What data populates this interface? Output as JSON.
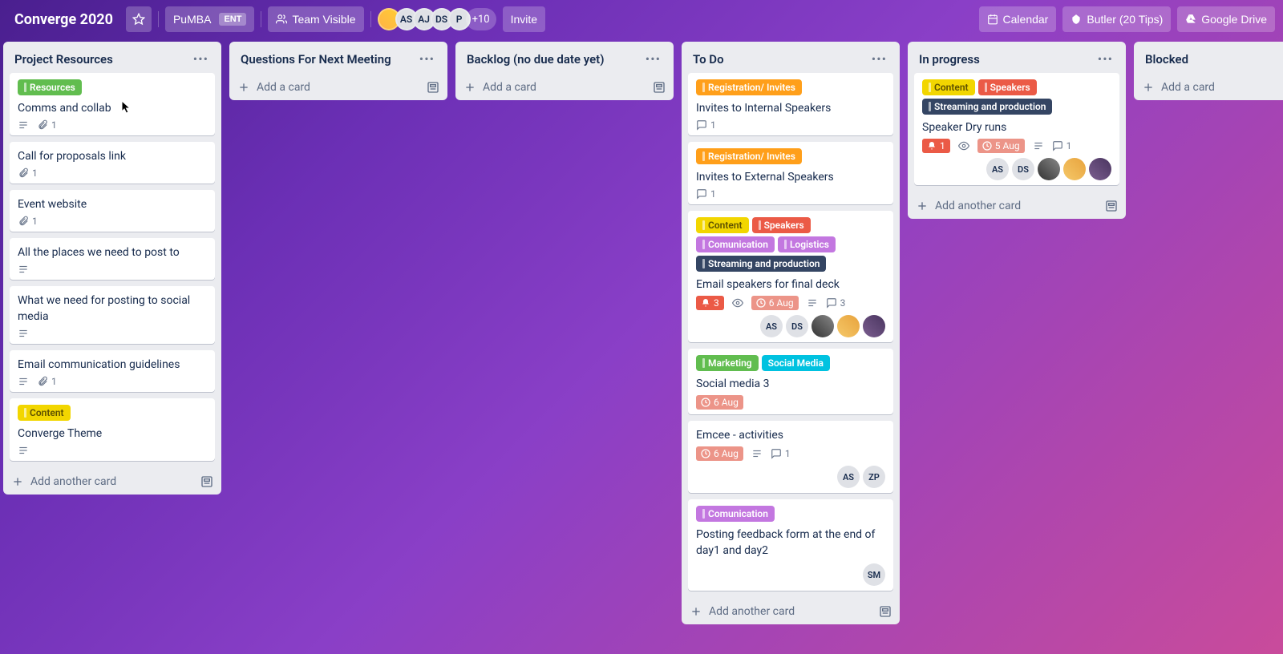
{
  "header": {
    "title": "Converge 2020",
    "org": "PuMBA",
    "org_badge": "ENT",
    "visibility": "Team Visible",
    "members": [
      "",
      "AS",
      "AJ",
      "DS",
      "P"
    ],
    "more_members": "+10",
    "invite": "Invite",
    "buttons": {
      "calendar": "Calendar",
      "butler": "Butler (20 Tips)",
      "gdrive": "Google Drive"
    }
  },
  "labels": {
    "resources": "Resources",
    "content": "Content",
    "speakers": "Speakers",
    "streaming": "Streaming and production",
    "registration": "Registration/ Invites",
    "comunication": "Comunication",
    "logistics": "Logistics",
    "marketing": "Marketing",
    "social": "Social Media"
  },
  "ui": {
    "add_card": "Add a card",
    "add_another": "Add another card"
  },
  "lists": [
    {
      "title": "Project Resources",
      "footer_another": true,
      "cards": [
        {
          "labels": [
            {
              "k": "resources",
              "cls": "lbl-green",
              "stripe": true
            }
          ],
          "title": "Comms and collab",
          "desc": true,
          "att": 1
        },
        {
          "title": "Call for proposals link",
          "att": 1
        },
        {
          "title": "Event website",
          "att": 1
        },
        {
          "title": "All the places we need to post to",
          "desc": true
        },
        {
          "title": "What we need for posting to social media",
          "desc": true
        },
        {
          "title": "Email communication guidelines",
          "desc": true,
          "att": 1
        },
        {
          "labels": [
            {
              "k": "content",
              "cls": "lbl-yellow",
              "stripe": true
            }
          ],
          "title": "Converge Theme",
          "desc": true
        }
      ]
    },
    {
      "title": "Questions For Next Meeting",
      "cards": []
    },
    {
      "title": "Backlog (no due date yet)",
      "cards": []
    },
    {
      "title": "To Do",
      "footer_another": true,
      "cards": [
        {
          "labels": [
            {
              "k": "registration",
              "cls": "lbl-orange",
              "stripe": true
            }
          ],
          "title": "Invites to Internal Speakers",
          "comments": 1
        },
        {
          "labels": [
            {
              "k": "registration",
              "cls": "lbl-orange",
              "stripe": true
            }
          ],
          "title": "Invites to External Speakers",
          "comments": 1
        },
        {
          "labels": [
            {
              "k": "content",
              "cls": "lbl-yellow",
              "stripe": true
            },
            {
              "k": "speakers",
              "cls": "lbl-red",
              "stripe": true
            },
            {
              "k": "comunication",
              "cls": "lbl-purple",
              "stripe": true
            },
            {
              "k": "logistics",
              "cls": "lbl-purple",
              "stripe": true
            },
            {
              "k": "streaming",
              "cls": "lbl-dark",
              "stripe": true
            }
          ],
          "title": "Email speakers for final deck",
          "notif": 3,
          "watch": true,
          "due": "6 Aug",
          "desc": true,
          "comments": 3,
          "members": [
            "AS",
            "DS",
            "img1",
            "img2",
            "img3"
          ]
        },
        {
          "labels": [
            {
              "k": "marketing",
              "cls": "lbl-green",
              "stripe": true
            },
            {
              "k": "social",
              "cls": "lbl-sky"
            }
          ],
          "title": "Social media 3",
          "due": "6 Aug"
        },
        {
          "title": "Emcee - activities",
          "due": "6 Aug",
          "desc": true,
          "comments": 1,
          "members": [
            "AS",
            "ZP"
          ]
        },
        {
          "labels": [
            {
              "k": "comunication",
              "cls": "lbl-purple",
              "stripe": true
            }
          ],
          "title": "Posting feedback form at the end of day1 and day2",
          "members": [
            "SM"
          ]
        }
      ]
    },
    {
      "title": "In progress",
      "footer_another": true,
      "cards": [
        {
          "labels": [
            {
              "k": "content",
              "cls": "lbl-yellow",
              "stripe": true
            },
            {
              "k": "speakers",
              "cls": "lbl-red",
              "stripe": true
            },
            {
              "k": "streaming",
              "cls": "lbl-dark",
              "stripe": true
            }
          ],
          "title": "Speaker Dry runs",
          "notif": 1,
          "watch": true,
          "due": "5 Aug",
          "desc": true,
          "comments": 1,
          "members": [
            "AS",
            "DS",
            "img1",
            "img2",
            "img3"
          ]
        }
      ]
    },
    {
      "title": "Blocked",
      "cards": []
    }
  ]
}
